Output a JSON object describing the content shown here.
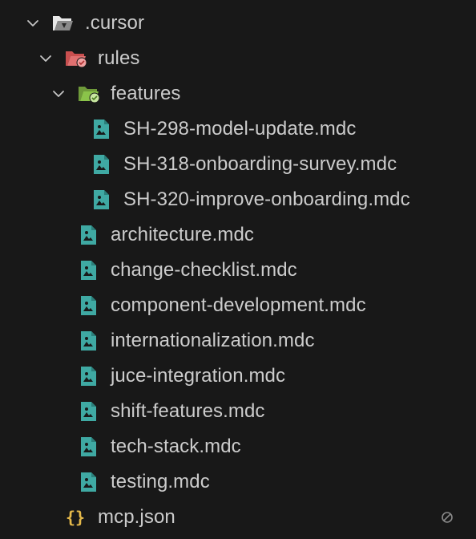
{
  "explorer": {
    "root_folder": {
      "label": ".cursor",
      "icon": "folder-open-icon",
      "expanded": true
    },
    "rules_folder": {
      "label": "rules",
      "icon": "folder-open-red-icon",
      "expanded": true
    },
    "features_folder": {
      "label": "features",
      "icon": "folder-open-green-icon",
      "expanded": true
    },
    "feature_files": [
      {
        "label": "SH-298-model-update.mdc"
      },
      {
        "label": "SH-318-onboarding-survey.mdc"
      },
      {
        "label": "SH-320-improve-onboarding.mdc"
      }
    ],
    "rule_files": [
      {
        "label": "architecture.mdc"
      },
      {
        "label": "change-checklist.mdc"
      },
      {
        "label": "component-development.mdc"
      },
      {
        "label": "internationalization.mdc"
      },
      {
        "label": "juce-integration.mdc"
      },
      {
        "label": "shift-features.mdc"
      },
      {
        "label": "tech-stack.mdc"
      },
      {
        "label": "testing.mdc"
      }
    ],
    "json_file": {
      "label": "mcp.json",
      "icon": "json-braces-icon",
      "status_icon": "ignored-icon"
    }
  },
  "colors": {
    "background": "#181818",
    "text": "#cccccc",
    "chevron": "#c5c5c5",
    "mdc_icon": "#3fa9a3",
    "rules_folder": "#e06c6c",
    "features_folder": "#8bc34a",
    "json_braces": "#e5b94a"
  }
}
